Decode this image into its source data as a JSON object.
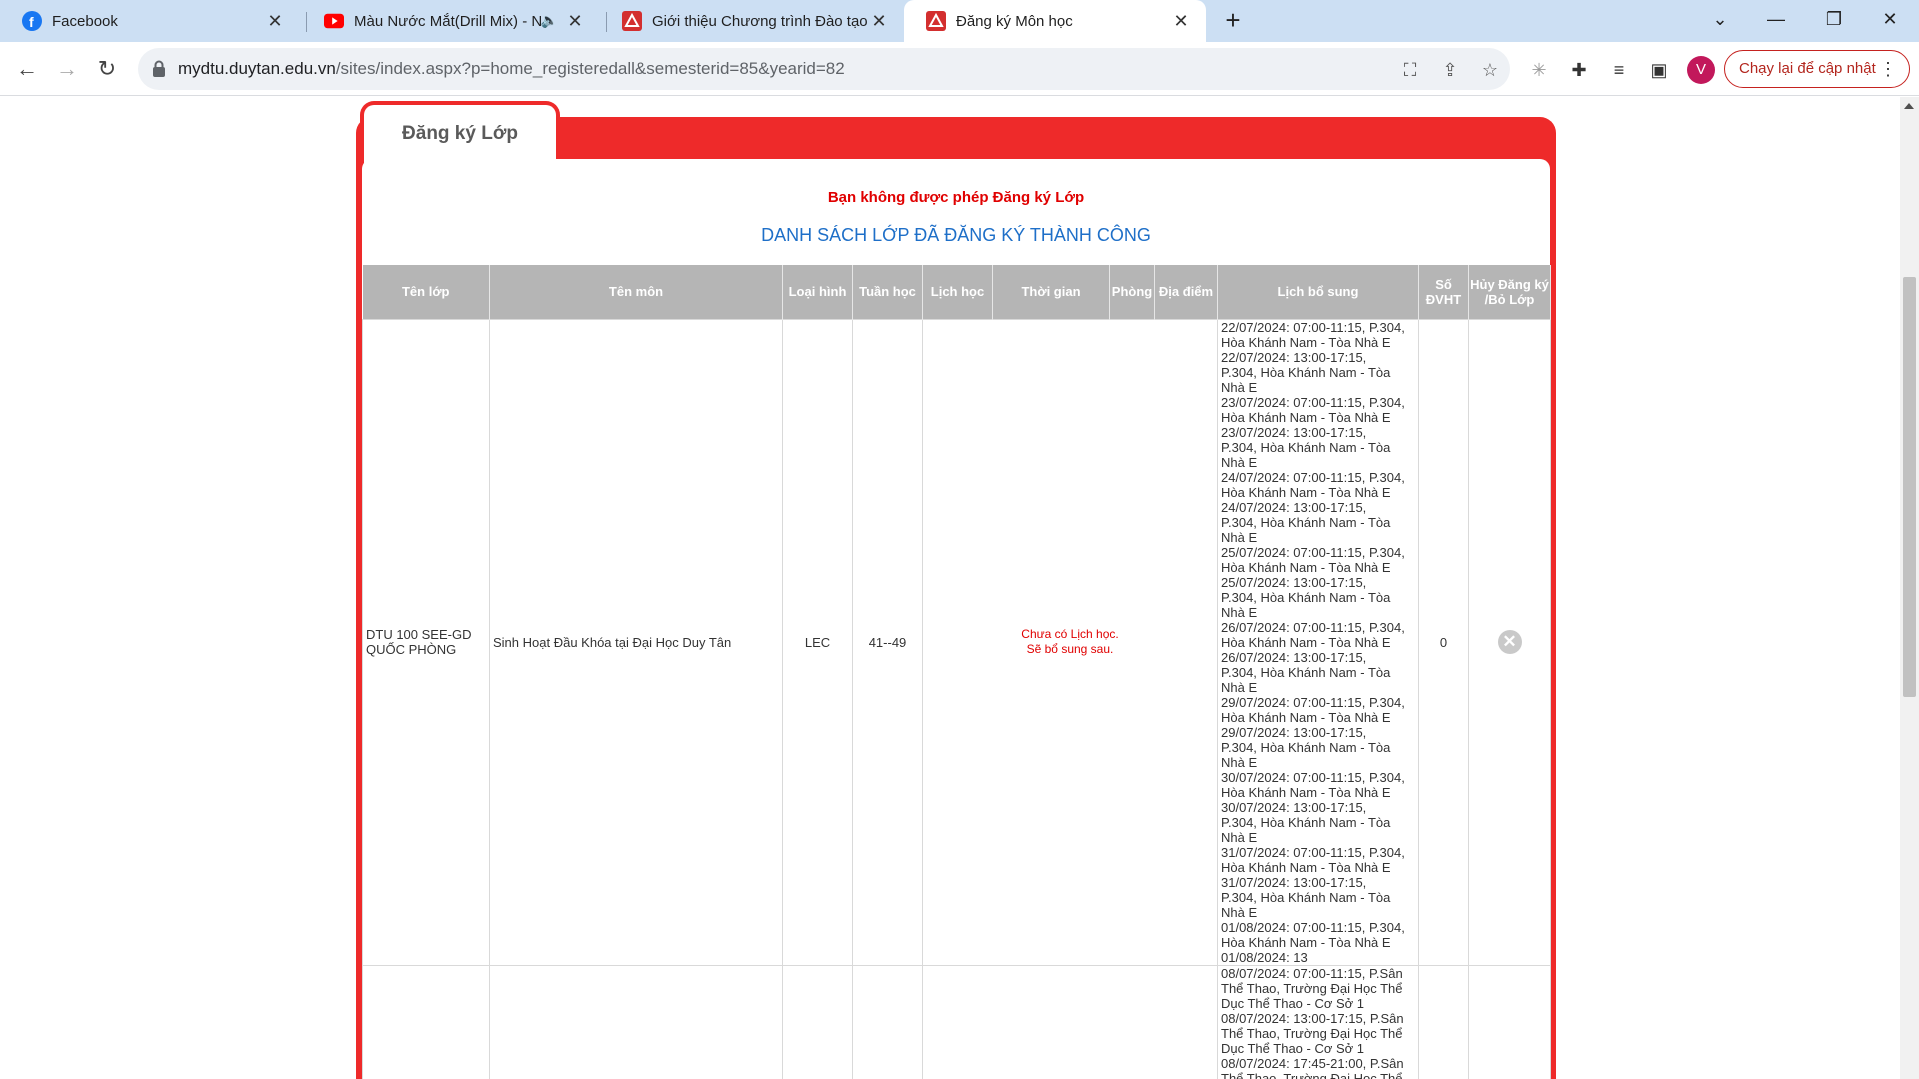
{
  "browser": {
    "tabs": [
      {
        "title": "Facebook",
        "icon": "facebook-icon"
      },
      {
        "title": "Màu Nước Mắt(Drill Mix) - N",
        "icon": "youtube-icon"
      },
      {
        "title": "Giới thiệu Chương trình Đào tạo",
        "icon": "dtu-icon"
      },
      {
        "title": "Đăng ký Môn học",
        "icon": "dtu-icon"
      }
    ],
    "url_host": "mydtu.duytan.edu.vn",
    "url_path": "/sites/index.aspx?p=home_registeredall&semesterid=85&yearid=82",
    "avatar_letter": "V",
    "update_label": "Chạy lại để cập nhật"
  },
  "page": {
    "panel_title": "Đăng ký Lớp",
    "warning": "Bạn không được phép Đăng ký Lớp",
    "subtitle": "DANH SÁCH LỚP ĐÃ ĐĂNG KÝ THÀNH CÔNG",
    "colors": {
      "panel": "#ee2a2a",
      "header": "#b5b5b5",
      "subtitle": "#1e6fc8",
      "warning": "#e00000"
    },
    "columns": {
      "class_name": "Tên lớp",
      "subject": "Tên môn",
      "type": "Loại hình",
      "weeks": "Tuần học",
      "schedule": "Lịch học",
      "time": "Thời gian",
      "room": "Phòng",
      "location": "Địa điểm",
      "extra": "Lịch bổ sung",
      "credits": "Số ĐVHT",
      "cancel": "Hủy Đăng ký /Bỏ Lớp"
    },
    "rows": [
      {
        "class_name": "DTU 100 SEE-GD QUỐC PHÒNG",
        "subject": "Sinh Hoạt Đầu Khóa tại Đại Học Duy Tân",
        "type": "LEC",
        "weeks": "41--49",
        "no_schedule": "Chưa có Lịch học.\nSẽ bổ sung sau.",
        "credits": "0",
        "extra": "22/07/2024: 07:00-11:15, P.304,\nHòa Khánh Nam - Tòa Nhà E\n22/07/2024: 13:00-17:15,\nP.304, Hòa Khánh Nam - Tòa\nNhà E\n23/07/2024: 07:00-11:15, P.304,\nHòa Khánh Nam - Tòa Nhà E\n23/07/2024: 13:00-17:15,\nP.304, Hòa Khánh Nam - Tòa\nNhà E\n24/07/2024: 07:00-11:15, P.304,\nHòa Khánh Nam - Tòa Nhà E\n24/07/2024: 13:00-17:15,\nP.304, Hòa Khánh Nam - Tòa\nNhà E\n25/07/2024: 07:00-11:15, P.304,\nHòa Khánh Nam - Tòa Nhà E\n25/07/2024: 13:00-17:15,\nP.304, Hòa Khánh Nam - Tòa\nNhà E\n26/07/2024: 07:00-11:15, P.304,\nHòa Khánh Nam - Tòa Nhà E\n26/07/2024: 13:00-17:15,\nP.304, Hòa Khánh Nam - Tòa\nNhà E\n29/07/2024: 07:00-11:15, P.304,\nHòa Khánh Nam - Tòa Nhà E\n29/07/2024: 13:00-17:15,\nP.304, Hòa Khánh Nam - Tòa\nNhà E\n30/07/2024: 07:00-11:15, P.304,\nHòa Khánh Nam - Tòa Nhà E\n30/07/2024: 13:00-17:15,\nP.304, Hòa Khánh Nam - Tòa\nNhà E\n31/07/2024: 07:00-11:15, P.304,\nHòa Khánh Nam - Tòa Nhà E\n31/07/2024: 13:00-17:15,\nP.304, Hòa Khánh Nam - Tòa\nNhà E\n01/08/2024: 07:00-11:15, P.304,\nHòa Khánh Nam - Tòa Nhà E\n01/08/2024: 13"
      },
      {
        "class_name": "",
        "subject": "",
        "type": "",
        "weeks": "",
        "no_schedule": "",
        "credits": "",
        "extra": "08/07/2024: 07:00-11:15, P.Sân\nThể Thao, Trường Đại Học Thể\nDục Thể Thao - Cơ Sở 1\n08/07/2024: 13:00-17:15, P.Sân\nThể Thao, Trường Đại Học Thể\nDục Thể Thao - Cơ Sở 1\n08/07/2024: 17:45-21:00, P.Sân\nThể Thao, Trường Đại Học Thể"
      }
    ]
  }
}
